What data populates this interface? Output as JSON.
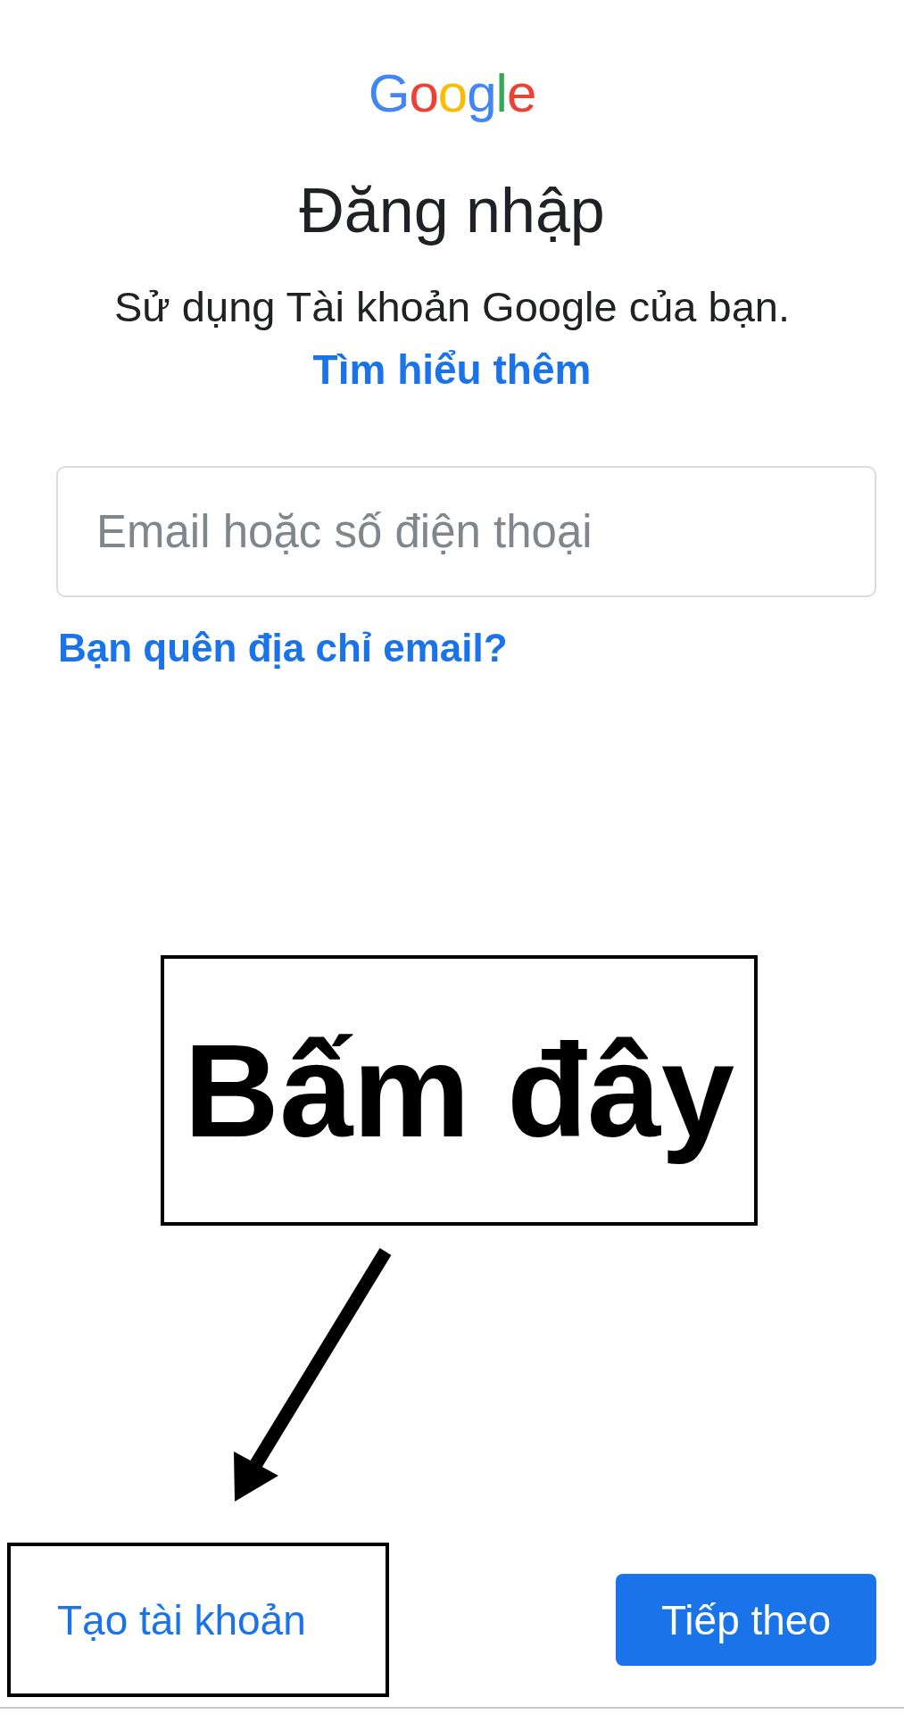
{
  "logo": "Google",
  "title": "Đăng nhập",
  "subtitle": "Sử dụng Tài khoản Google của bạn.",
  "learn_more_link": "Tìm hiểu thêm",
  "email_field": {
    "placeholder": "Email hoặc số điện thoại"
  },
  "forgot_email_link": "Bạn quên địa chỉ email?",
  "annotation": {
    "label": "Bấm đây"
  },
  "footer": {
    "create_account_link": "Tạo tài khoản",
    "next_button": "Tiếp theo"
  }
}
